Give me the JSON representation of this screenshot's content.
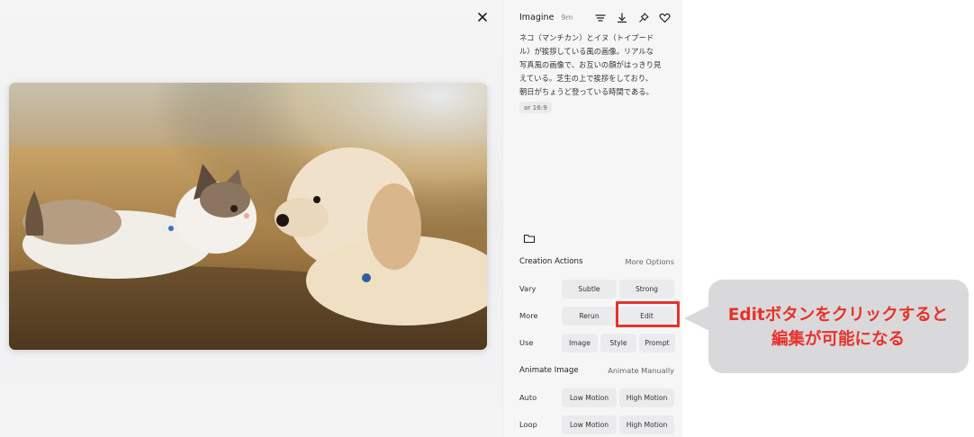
{
  "viewer": {
    "close_icon": "close-icon",
    "image_desc_icon": "photo-cat-and-dog"
  },
  "panel": {
    "title": "Imagine",
    "time": "9m",
    "icons": [
      "menu-lines-icon",
      "download-icon",
      "pin-icon",
      "heart-icon"
    ],
    "prompt_lines": [
      "ネコ（マンチカン）とイヌ（トイプード",
      "ル）が挨拶している風の画像。リアルな",
      "写真風の画像で、お互いの顔がはっきり見",
      "えている。芝生の上で挨拶をしており、",
      "朝日がちょうど登っている時間である。"
    ],
    "ar_badge": "ar 16:9",
    "folder_icon": "folder-icon"
  },
  "creation": {
    "heading": "Creation Actions",
    "more_options": "More Options",
    "vary_label": "Vary",
    "vary_subtle": "Subtle",
    "vary_strong": "Strong",
    "more_label": "More",
    "rerun": "Rerun",
    "edit": "Edit",
    "use_label": "Use",
    "use_image": "Image",
    "use_style": "Style",
    "use_prompt": "Prompt"
  },
  "animate": {
    "heading": "Animate Image",
    "manual": "Animate Manually",
    "auto_label": "Auto",
    "auto_low": "Low Motion",
    "auto_high": "High Motion",
    "loop_label": "Loop",
    "loop_low": "Low Motion",
    "loop_high": "High Motion"
  },
  "callout": {
    "line1": "Editボタンをクリックすると",
    "line2": "編集が可能になる"
  },
  "colors": {
    "accent_red": "#e8322c",
    "callout_bg": "#d9d9db",
    "button_bg": "#ebebed"
  }
}
